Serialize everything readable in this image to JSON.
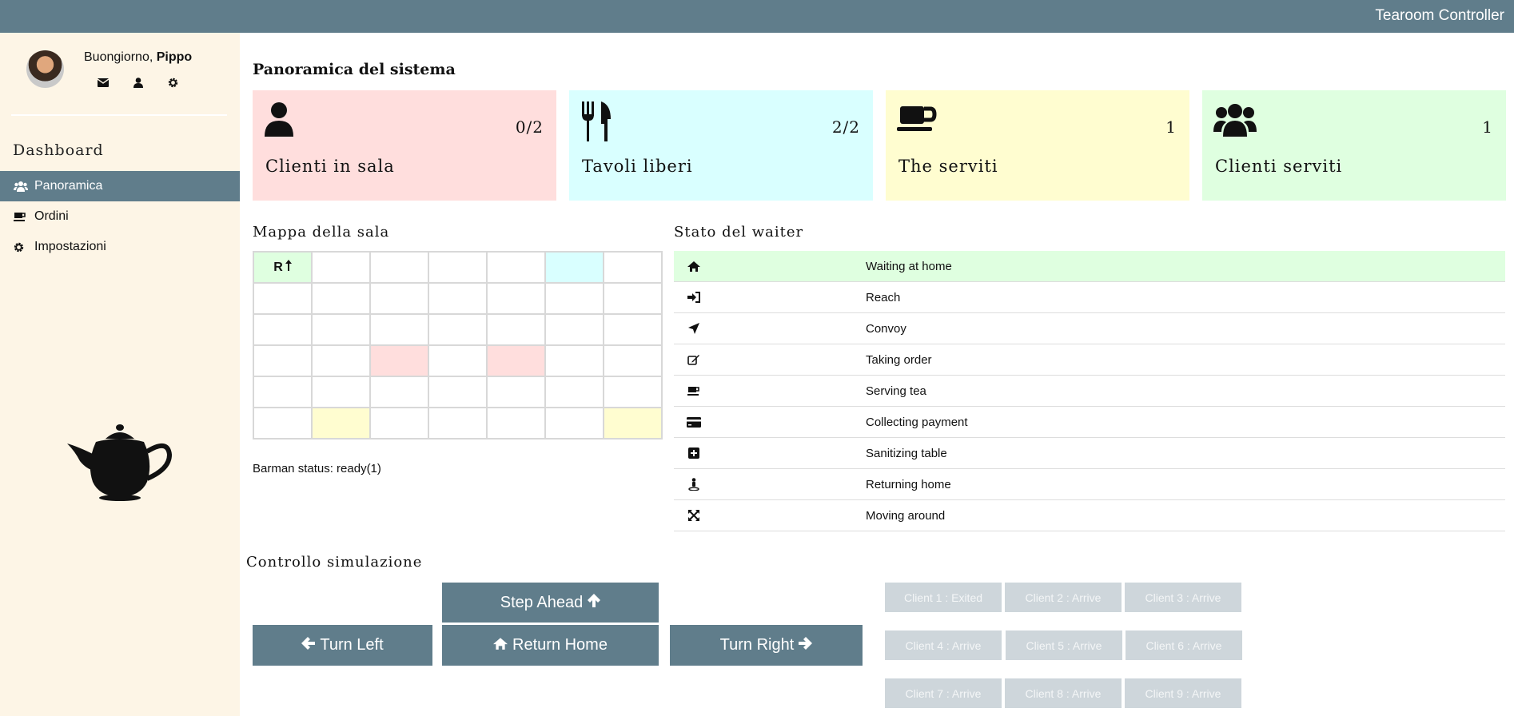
{
  "app": {
    "title": "Tearoom Controller"
  },
  "user": {
    "greeting": "Buongiorno,",
    "name": "Pippo"
  },
  "sidebar": {
    "section_title": "Dashboard",
    "items": [
      {
        "label": "Panoramica",
        "icon": "users-icon",
        "active": true
      },
      {
        "label": "Ordini",
        "icon": "coffee-icon",
        "active": false
      },
      {
        "label": "Impostazioni",
        "icon": "gear-icon",
        "active": false
      }
    ]
  },
  "overview": {
    "title": "Panoramica del sistema",
    "cards": [
      {
        "label": "Clienti in sala",
        "value": "0/2",
        "icon": "user-icon",
        "color": "#ffdedd"
      },
      {
        "label": "Tavoli liberi",
        "value": "2/2",
        "icon": "utensils-icon",
        "color": "#d9ffff"
      },
      {
        "label": "The serviti",
        "value": "1",
        "icon": "coffee-icon",
        "color": "#fffdd0"
      },
      {
        "label": "Clienti serviti",
        "value": "1",
        "icon": "users-icon",
        "color": "#dfffe0"
      }
    ]
  },
  "map": {
    "title": "Mappa della sala",
    "robot_label": "R",
    "robot_direction": "up",
    "cells": [
      [
        "robot",
        "",
        "",
        "",
        "",
        "cyan",
        ""
      ],
      [
        "",
        "",
        "",
        "",
        "",
        "",
        ""
      ],
      [
        "",
        "",
        "",
        "",
        "",
        "",
        ""
      ],
      [
        "",
        "",
        "pink",
        "",
        "pink",
        "",
        ""
      ],
      [
        "",
        "",
        "",
        "",
        "",
        "",
        ""
      ],
      [
        "",
        "yellow",
        "",
        "",
        "",
        "",
        "yellow"
      ]
    ],
    "colors": {
      "robot": "#dfffe0",
      "cyan": "#d9ffff",
      "pink": "#ffdedd",
      "yellow": "#fffdd0"
    }
  },
  "barman": {
    "status_text": "Barman status: ready(1)"
  },
  "waiter": {
    "title": "Stato del waiter",
    "states": [
      {
        "label": "Waiting at home",
        "icon": "home-icon",
        "active": true
      },
      {
        "label": "Reach",
        "icon": "sign-in-icon",
        "active": false
      },
      {
        "label": "Convoy",
        "icon": "location-arrow-icon",
        "active": false
      },
      {
        "label": "Taking order",
        "icon": "edit-icon",
        "active": false
      },
      {
        "label": "Serving tea",
        "icon": "coffee-icon",
        "active": false
      },
      {
        "label": "Collecting payment",
        "icon": "credit-card-icon",
        "active": false
      },
      {
        "label": "Sanitizing table",
        "icon": "plus-square-icon",
        "active": false
      },
      {
        "label": "Returning home",
        "icon": "street-view-icon",
        "active": false
      },
      {
        "label": "Moving around",
        "icon": "arrows-icon",
        "active": false
      }
    ]
  },
  "simulation": {
    "title": "Controllo simulazione",
    "buttons": {
      "step_ahead": "Step Ahead",
      "turn_left": "Turn Left",
      "return_home": "Return Home",
      "turn_right": "Turn Right"
    },
    "clients": [
      "Client 1 : Exited",
      "Client 2 : Arrive",
      "Client 3 : Arrive",
      "Client 4 : Arrive",
      "Client 5 : Arrive",
      "Client 6 : Arrive",
      "Client 7 : Arrive",
      "Client 8 : Arrive",
      "Client 9 : Arrive"
    ]
  }
}
